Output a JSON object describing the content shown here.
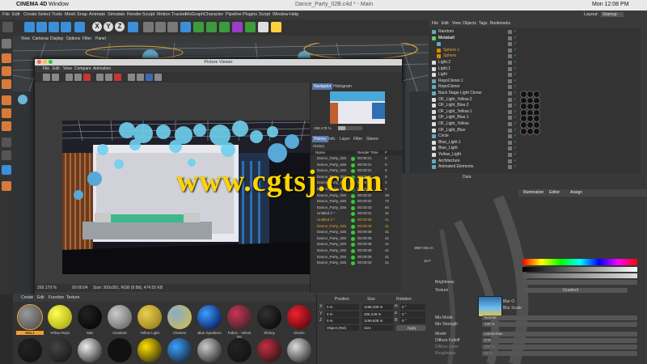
{
  "mac_menu": {
    "app": "CINEMA 4D",
    "window": "Window",
    "clock": "Mon 12:08 PM"
  },
  "title_bar": "Dance_Party_02B.c4d * - Main",
  "c4d_menu": [
    "File",
    "Edit",
    "Create",
    "Select",
    "Tools",
    "Mesh",
    "Snap",
    "Animate",
    "Simulate",
    "Render",
    "Sculpt",
    "Motion Tracker",
    "MoGraph",
    "Character",
    "Pipeline",
    "Plugins",
    "Script",
    "Window",
    "Help"
  ],
  "layout": {
    "label": "Layout:",
    "value": "Startup"
  },
  "toolbar_axes": [
    "X",
    "Y",
    "Z"
  ],
  "viewport_menu": [
    "View",
    "Cameras",
    "Display",
    "Options",
    "Filter",
    "Panel"
  ],
  "picture_viewer": {
    "title": "Picture Viewer",
    "menu": [
      "File",
      "Edit",
      "View",
      "Compare",
      "Animation"
    ],
    "nav_tabs": [
      "Navigator",
      "Histogram"
    ],
    "zoom": "269.179 %",
    "history_tabs": [
      "History",
      "Info",
      "Layer",
      "Filter",
      "Stereo"
    ],
    "history_label": "History",
    "history_headers": [
      "Name",
      "Render Time",
      "F"
    ],
    "history_rows": [
      {
        "name": "Dance_Party_026",
        "time": "00:00:01",
        "f": "0"
      },
      {
        "name": "Dance_Party_026",
        "time": "00:00:01",
        "f": "0"
      },
      {
        "name": "Dance_Party_026",
        "time": "00:00:01",
        "f": "0"
      },
      {
        "name": "Dance_Party_026",
        "time": "00:00:01",
        "f": "0"
      },
      {
        "name": "Dance_Party_026",
        "time": "00:00:01",
        "f": "0"
      },
      {
        "name": "Dance_Party_026",
        "time": "00:00:01",
        "f": "0"
      },
      {
        "name": "Dance_Party_026",
        "time": "00:00:02",
        "f": "38"
      },
      {
        "name": "Dance_Party_026",
        "time": "00:00:02",
        "f": "72"
      },
      {
        "name": "Dance_Party_026",
        "time": "00:00:03",
        "f": "84"
      },
      {
        "name": "Untitled 2 *",
        "time": "00:00:01",
        "f": "41"
      },
      {
        "name": "Untitled 2 *",
        "time": "00:00:08",
        "f": "41"
      },
      {
        "name": "Dance_Party_026",
        "time": "00:00:08",
        "f": "41"
      },
      {
        "name": "Dance_Party_026",
        "time": "00:00:08",
        "f": "41"
      },
      {
        "name": "Dance_Party_026",
        "time": "00:00:08",
        "f": "41"
      },
      {
        "name": "Dance_Party_026",
        "time": "00:00:08",
        "f": "41"
      },
      {
        "name": "Dance_Party_026",
        "time": "00:00:08",
        "f": "41"
      },
      {
        "name": "Dance_Party_026",
        "time": "00:00:08",
        "f": "41"
      },
      {
        "name": "Dance_Party_026",
        "time": "00:00:04",
        "f": "41"
      }
    ],
    "status_zoom": "269.179 %",
    "status_time": "00:00:04",
    "status_size": "Size: 300x281, RGB (8 Bit), 474.55 KB"
  },
  "object_manager": {
    "menu": [
      "File",
      "Edit",
      "View",
      "Objects",
      "Tags",
      "Bookmarks"
    ],
    "objects": [
      {
        "name": "Random",
        "color": "#6ab"
      },
      {
        "name": "Metaball",
        "color": "#6c6"
      },
      {
        "name": "",
        "color": "#6ab"
      },
      {
        "name": "Sphere.1",
        "color": "#d80"
      },
      {
        "name": "Sphere",
        "color": "#d80"
      },
      {
        "name": "Light.2",
        "color": "#ddd"
      },
      {
        "name": "Light.1",
        "color": "#ddd"
      },
      {
        "name": "Light",
        "color": "#ddd"
      },
      {
        "name": "RepoCloner.1",
        "color": "#6ab"
      },
      {
        "name": "RepoCloner",
        "color": "#6ab"
      },
      {
        "name": "Back Stage Light Cloner",
        "color": "#6ab"
      },
      {
        "name": "OF_Light_Yellow.2",
        "color": "#ddd"
      },
      {
        "name": "OF_Light_Blue.2",
        "color": "#ddd"
      },
      {
        "name": "OF_Light_Yellow.1",
        "color": "#ddd"
      },
      {
        "name": "OF_Light_Blue.1",
        "color": "#ddd"
      },
      {
        "name": "OF_Light_Yellow",
        "color": "#ddd"
      },
      {
        "name": "OF_Light_Blue",
        "color": "#ddd"
      },
      {
        "name": "Circle",
        "color": "#6ab"
      },
      {
        "name": "Blue_Light.1",
        "color": "#ddd"
      },
      {
        "name": "Blue_Light",
        "color": "#ddd"
      },
      {
        "name": "Yellow_Light",
        "color": "#ddd"
      },
      {
        "name": "Architecture",
        "color": "#6ab"
      },
      {
        "name": "Animated Elements",
        "color": "#6ab"
      }
    ]
  },
  "attribute": {
    "mode_label": "Data",
    "tabs": [
      "Illumination",
      "Editor",
      "Assign"
    ],
    "brightness": "Brightness",
    "texture": "Texture",
    "texture_value": "Gradient",
    "blur_offset": "Blur O",
    "blur_scale": "Blur Scale",
    "mix_mode": {
      "label": "Mix Mode",
      "value": "Normal"
    },
    "mix_strength": {
      "label": "Mix Strength",
      "value": "100 %"
    },
    "model": {
      "label": "Model",
      "value": "Lambertian"
    },
    "diffuse_falloff": {
      "label": "Diffuse Falloff",
      "value": "0 %"
    },
    "diffuse_level": {
      "label": "Diffuse Level",
      "value": "100 %"
    },
    "roughness": {
      "label": "Roughness",
      "value": "50 %"
    },
    "frame_value": "3997.904 m",
    "frame_label": "34 F"
  },
  "material_manager": {
    "menu": [
      "Create",
      "Edit",
      "Function",
      "Texture"
    ],
    "materials": [
      {
        "name": "Mat.1",
        "selected": true,
        "colors": [
          "#9a9a9a",
          "#444"
        ]
      },
      {
        "name": "Yellow Rays",
        "colors": [
          "#ffff55",
          "#999900"
        ]
      },
      {
        "name": "Mat",
        "colors": [
          "#222",
          "#000"
        ]
      },
      {
        "name": "Gradient",
        "colors": [
          "#ccc",
          "#555"
        ]
      },
      {
        "name": "Yellow Light",
        "colors": [
          "#e8d050",
          "#8a7010"
        ]
      },
      {
        "name": "Chekers",
        "colors": [
          "#8ac",
          "#d8c040"
        ]
      },
      {
        "name": "Blue Speakers",
        "colors": [
          "#3aa0ff",
          "#004"
        ]
      },
      {
        "name": "Fabric - Velvet Re",
        "colors": [
          "#cc3355",
          "#222"
        ]
      },
      {
        "name": "Shinny",
        "colors": [
          "#333",
          "#000"
        ]
      },
      {
        "name": "Drums",
        "colors": [
          "#ee2233",
          "#400"
        ]
      }
    ],
    "row2_colors": [
      "#222",
      "#444",
      "#eee",
      "#111",
      "#ffe000",
      "#3aa0ff",
      "#ccc",
      "#222",
      "#c03040",
      "#ddd"
    ]
  },
  "coordinates": {
    "headers": [
      "Position",
      "Size",
      "Rotation"
    ],
    "rows": [
      {
        "axis": "X",
        "pos": "0 m",
        "size": "1198.339 m",
        "rotlbl": "H",
        "rot": "0 °"
      },
      {
        "axis": "Y",
        "pos": "0 m",
        "size": "206.248 m",
        "rotlbl": "P",
        "rot": "0 °"
      },
      {
        "axis": "Z",
        "pos": "0 m",
        "size": "1199.608 m",
        "rotlbl": "B",
        "rot": "0 °"
      }
    ],
    "mode": "Object (Rel)",
    "size_mode": "Size",
    "apply": "Apply"
  },
  "watermark": "www.cgtsj.com"
}
